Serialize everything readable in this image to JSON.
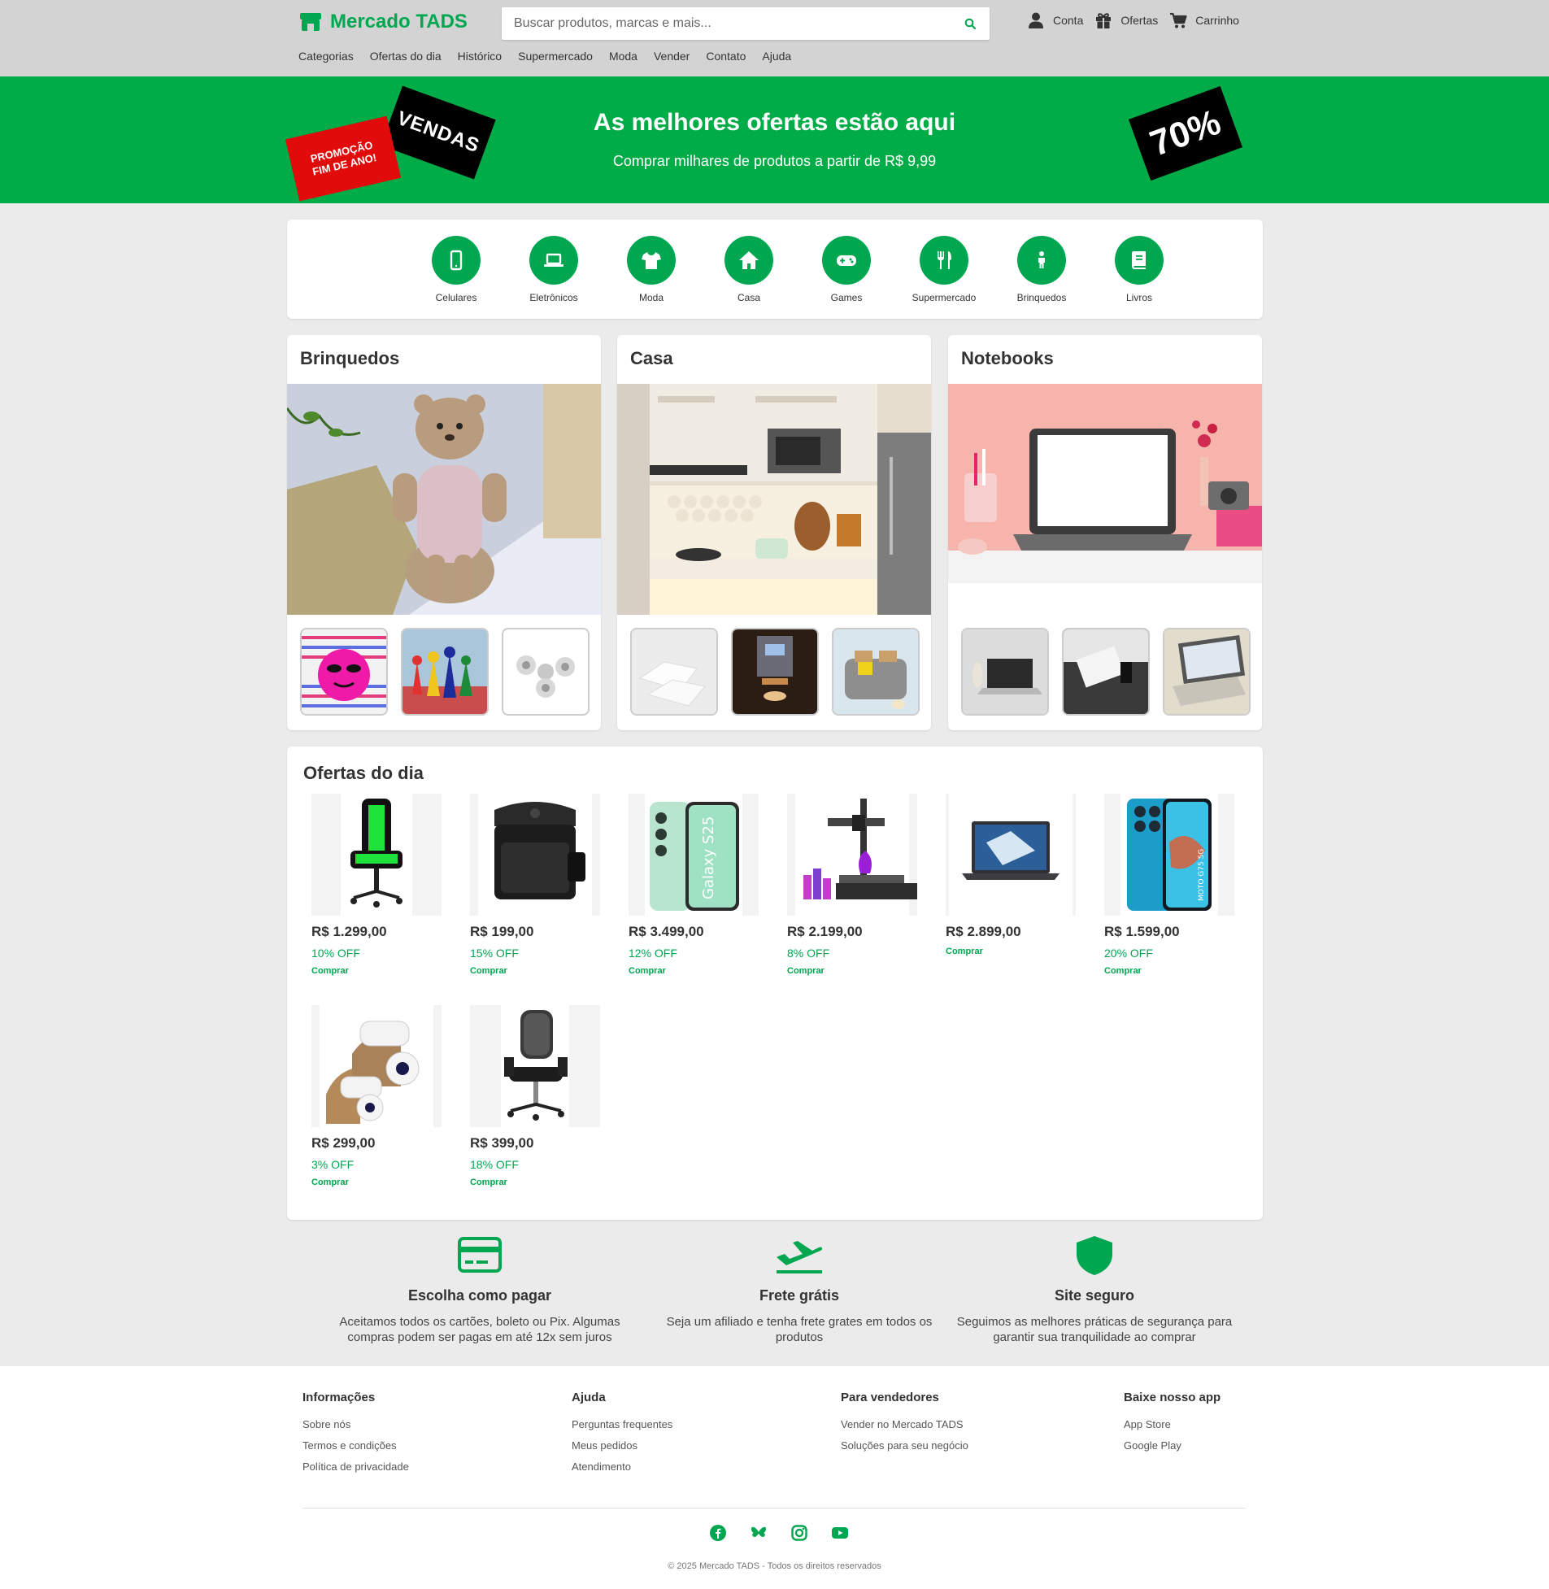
{
  "header": {
    "logo_text": "Mercado TADS",
    "search_placeholder": "Buscar produtos, marcas e mais...",
    "actions": [
      {
        "label": "Conta",
        "icon": "user-icon"
      },
      {
        "label": "Ofertas",
        "icon": "gift-icon"
      },
      {
        "label": "Carrinho",
        "icon": "cart-icon"
      }
    ],
    "nav": [
      "Categorias",
      "Ofertas do dia",
      "Histórico",
      "Supermercado",
      "Moda",
      "Vender",
      "Contato",
      "Ajuda"
    ]
  },
  "banner": {
    "title": "As melhores ofertas estão aqui",
    "subtitle": "Comprar milhares de produtos a partir de R$ 9,99",
    "tag_promo": "PROMOÇÃO FIM DE ANO!",
    "tag_vendas": "VENDAS",
    "tag_discount": "70%"
  },
  "categories": [
    {
      "label": "Celulares",
      "icon": "phone-icon"
    },
    {
      "label": "Eletrônicos",
      "icon": "laptop-icon"
    },
    {
      "label": "Moda",
      "icon": "shirt-icon"
    },
    {
      "label": "Casa",
      "icon": "house-icon"
    },
    {
      "label": "Games",
      "icon": "gamepad-icon"
    },
    {
      "label": "Supermercado",
      "icon": "utensils-icon"
    },
    {
      "label": "Brinquedos",
      "icon": "child-icon"
    },
    {
      "label": "Livros",
      "icon": "book-icon"
    }
  ],
  "featured": [
    {
      "title": "Brinquedos"
    },
    {
      "title": "Casa"
    },
    {
      "title": "Notebooks"
    }
  ],
  "offers": {
    "title": "Ofertas do dia",
    "products": [
      {
        "price": "R$ 1.299,00",
        "off": "10% OFF",
        "buy": "Comprar",
        "image": "gaming-chair"
      },
      {
        "price": "R$ 199,00",
        "off": "15% OFF",
        "buy": "Comprar",
        "image": "air-fryer"
      },
      {
        "price": "R$ 3.499,00",
        "off": "12% OFF",
        "buy": "Comprar",
        "image": "galaxy-phone"
      },
      {
        "price": "R$ 2.199,00",
        "off": "8% OFF",
        "buy": "Comprar",
        "image": "3d-printer"
      },
      {
        "price": "R$ 2.899,00",
        "off": "",
        "buy": "Comprar",
        "image": "laptop"
      },
      {
        "price": "R$ 1.599,00",
        "off": "20% OFF",
        "buy": "Comprar",
        "image": "moto-phone"
      },
      {
        "price": "R$ 299,00",
        "off": "3% OFF",
        "buy": "Comprar",
        "image": "security-cameras"
      },
      {
        "price": "R$ 399,00",
        "off": "18% OFF",
        "buy": "Comprar",
        "image": "office-chair"
      }
    ]
  },
  "info": [
    {
      "title": "Escolha como pagar",
      "text": "Aceitamos todos os cartões, boleto ou Pix. Algumas compras podem ser pagas em até 12x sem juros",
      "icon": "credit-card-icon"
    },
    {
      "title": "Frete grátis",
      "text": "Seja um afiliado e tenha frete grates em todos os produtos",
      "icon": "plane-icon"
    },
    {
      "title": "Site seguro",
      "text": "Seguimos as melhores práticas de segurança para garantir sua tranquilidade ao comprar",
      "icon": "shield-icon"
    }
  ],
  "footer": {
    "columns": [
      {
        "title": "Informações",
        "links": [
          "Sobre nós",
          "Termos e condições",
          "Política de privacidade"
        ]
      },
      {
        "title": "Ajuda",
        "links": [
          "Perguntas frequentes",
          "Meus pedidos",
          "Atendimento"
        ]
      },
      {
        "title": "Para vendedores",
        "links": [
          "Vender no Mercado TADS",
          "Soluções para seu negócio"
        ]
      },
      {
        "title": "Baixe nosso app",
        "links": [
          "App Store",
          "Google Play"
        ]
      }
    ],
    "social": [
      "facebook-icon",
      "bluesky-icon",
      "instagram-icon",
      "youtube-icon"
    ],
    "copyright": "© 2025 Mercado TADS - Todos os direitos reservados"
  },
  "colors": {
    "brand": "#00a650",
    "banner": "#00ac47",
    "header_bg": "#d3d3d3",
    "page_bg": "#ebebeb"
  }
}
